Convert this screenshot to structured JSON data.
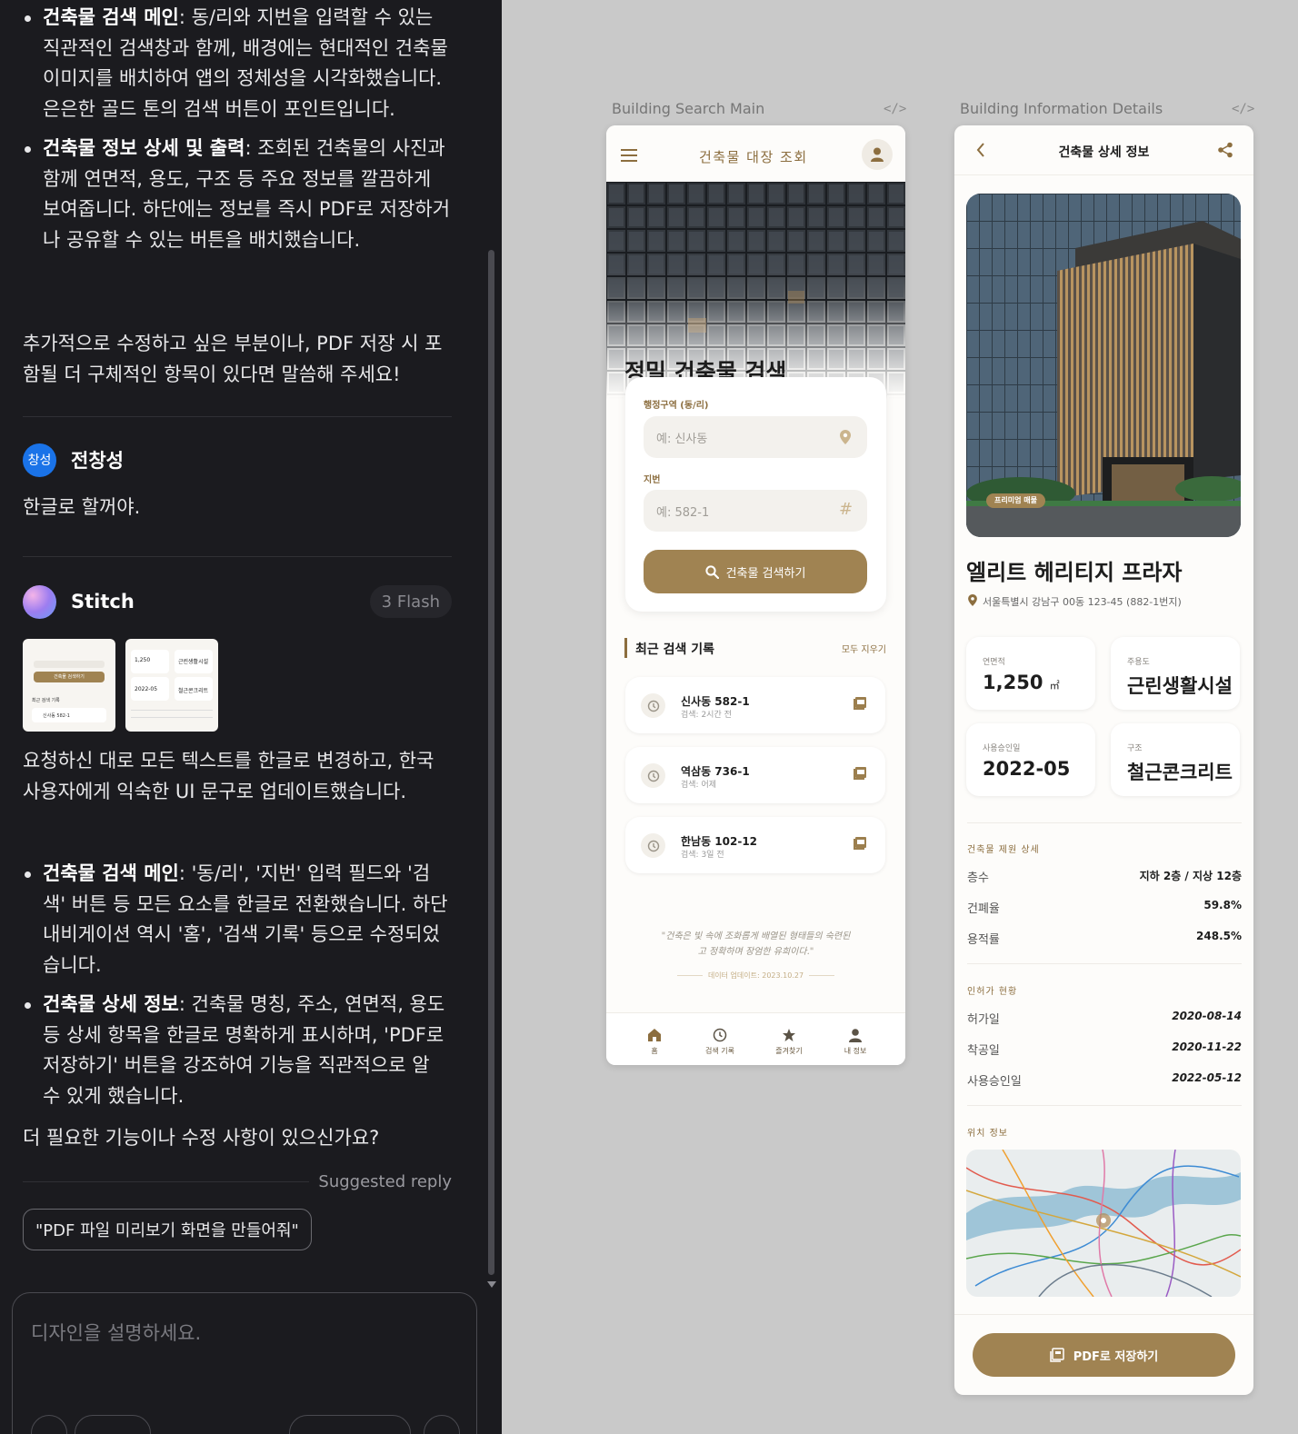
{
  "chat": {
    "intro_bullets": [
      {
        "bold": "건축물 검색 메인",
        "text": ": 동/리와 지번을 입력할 수 있는 직관적인 검색창과 함께, 배경에는 현대적인 건축물 이미지를 배치하여 앱의 정체성을 시각화했습니다. 은은한 골드 톤의 검색 버튼이 포인트입니다."
      },
      {
        "bold": "건축물 정보 상세 및 출력",
        "text": ": 조회된 건축물의 사진과 함께 연면적, 용도, 구조 등 주요 정보를 깔끔하게 보여줍니다. 하단에는 정보를 즉시 PDF로 저장하거나 공유할 수 있는 버튼을 배치했습니다."
      }
    ],
    "intro_closing": "추가적으로 수정하고 싶은 부분이나, PDF 저장 시 포함될 더 구체적인 항목이 있다면 말씀해 주세요!",
    "user": {
      "avatar_text": "창성",
      "name": "전창성",
      "message": "한글로 할꺼야."
    },
    "bot": {
      "name": "Stitch",
      "model_badge": "3 Flash",
      "message": "요청하신 대로 모든 텍스트를 한글로 변경하고, 한국 사용자에게 익숙한 UI 문구로 업데이트했습니다.",
      "bullets": [
        {
          "bold": "건축물 검색 메인",
          "text": ": '동/리', '지번' 입력 필드와 '검색' 버튼 등 모든 요소를 한글로 전환했습니다. 하단 내비게이션 역시 '홈', '검색 기록' 등으로 수정되었습니다."
        },
        {
          "bold": "건축물 상세 정보",
          "text": ": 건축물 명칭, 주소, 연면적, 용도 등 상세 항목을 한글로 명확하게 표시하며, 'PDF로 저장하기' 버튼을 강조하여 기능을 직관적으로 알 수 있게 했습니다."
        }
      ],
      "closing": "더 필요한 기능이나 수정 사항이 있으신가요?"
    },
    "suggested_label": "Suggested reply",
    "suggested_reply": "\"PDF 파일 미리보기 화면을 만들어줘\"",
    "composer_placeholder": "디자인을 설명하세요.",
    "thumb1": {
      "btn": "건축물 검색하기",
      "section": "최근 검색 기록",
      "item": "신사동 582-1"
    },
    "thumb2": {
      "area": "1,250",
      "use": "근린생활시설",
      "date": "2022-05",
      "struct": "철근콘크리트"
    }
  },
  "search_screen": {
    "artboard_label": "Building Search Main",
    "code_icon": "</>",
    "title": "건축물 대장 조회",
    "hero_title": "정밀 건축물 검색",
    "district_label": "행정구역 (동/리)",
    "district_placeholder": "예: 신사동",
    "lot_label": "지번",
    "lot_placeholder": "예: 582-1",
    "lot_icon": "#",
    "search_button": "건축물 검색하기",
    "recent_title": "최근 검색 기록",
    "clear_all": "모두 지우기",
    "history": [
      {
        "name": "신사동 582-1",
        "time": "검색: 2시간 전"
      },
      {
        "name": "역삼동 736-1",
        "time": "검색: 어제"
      },
      {
        "name": "한남동 102-12",
        "time": "검색: 3일 전"
      }
    ],
    "quote_line1": "\"건축은 빛 속에 조화롭게 배열된 형태들의 숙련된",
    "quote_line2": "고 정확하며 장엄한 유희이다.\"",
    "updated": "데이터 업데이트: 2023.10.27",
    "nav": [
      {
        "icon": "home-icon",
        "label": "홈"
      },
      {
        "icon": "history-icon",
        "label": "검색 기록"
      },
      {
        "icon": "star-icon",
        "label": "즐겨찾기"
      },
      {
        "icon": "person-icon",
        "label": "내 정보"
      }
    ]
  },
  "detail_screen": {
    "artboard_label": "Building Information Details",
    "code_icon": "</>",
    "title": "건축물 상세 정보",
    "badge": "프리미엄 매물",
    "name": "엘리트 헤리티지 프라자",
    "address": "서울특별시 강남구 00동 123-45 (882-1번지)",
    "stats": [
      {
        "label": "연면적",
        "value": "1,250",
        "unit": "㎡"
      },
      {
        "label": "주용도",
        "value": "근린생활시설",
        "unit": ""
      },
      {
        "label": "사용승인일",
        "value": "2022-05",
        "unit": ""
      },
      {
        "label": "구조",
        "value": "철근콘크리트",
        "unit": ""
      }
    ],
    "spec_title": "건축물 제원 상세",
    "specs": [
      {
        "k": "층수",
        "v": "지하 2층 / 지상 12층"
      },
      {
        "k": "건폐율",
        "v": "59.8%"
      },
      {
        "k": "용적률",
        "v": "248.5%"
      }
    ],
    "permit_title": "인허가 현황",
    "permits": [
      {
        "k": "허가일",
        "v": "2020-08-14"
      },
      {
        "k": "착공일",
        "v": "2020-11-22"
      },
      {
        "k": "사용승인일",
        "v": "2022-05-12"
      }
    ],
    "location_title": "위치 정보",
    "pdf_button": "PDF로 저장하기"
  },
  "colors": {
    "gold": "#9c7f4e",
    "chat_bg": "#1b1b1f",
    "canvas_bg": "#c9c9c9"
  }
}
